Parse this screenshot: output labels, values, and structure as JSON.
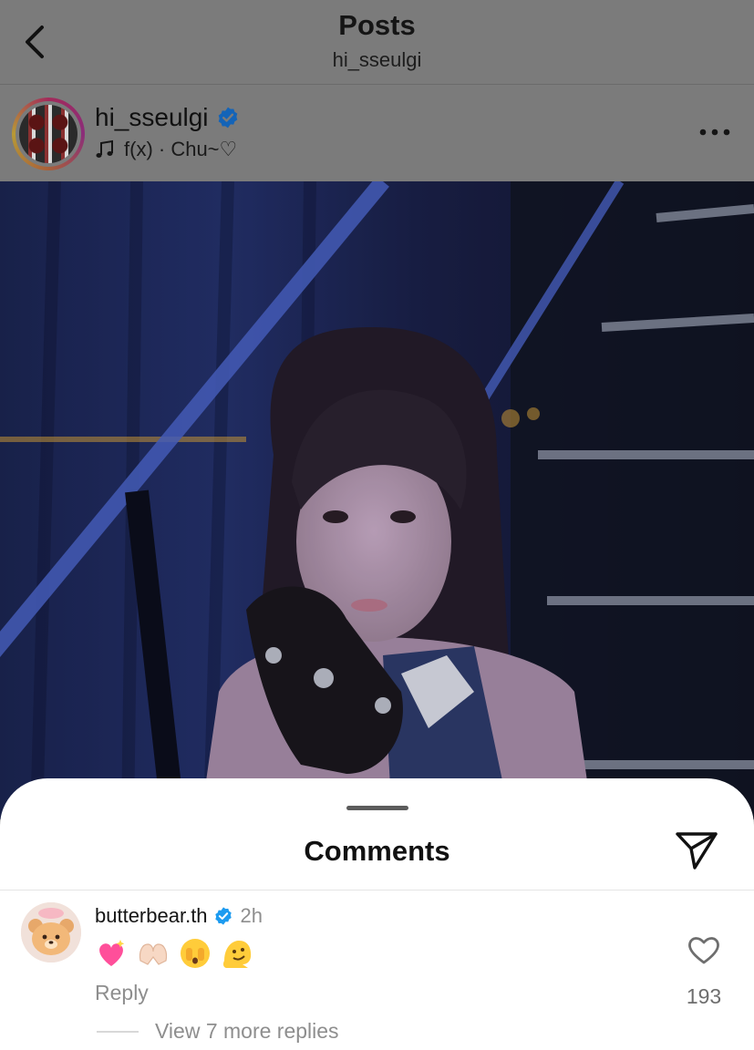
{
  "header": {
    "title": "Posts",
    "subtitle": "hi_sseulgi"
  },
  "post": {
    "username": "hi_sseulgi",
    "verified": true,
    "music": "f(x) · Chu~♡",
    "icons": [
      "back-chevron-icon",
      "music-note-icon",
      "verified-badge-icon",
      "more-dots-icon"
    ]
  },
  "comments_sheet": {
    "title": "Comments",
    "comment": {
      "username": "butterbear.th",
      "verified": true,
      "time": "2h",
      "emojis": [
        "sparkling-heart",
        "heart-hands",
        "face-holding-back-tears",
        "melting-face"
      ],
      "reply_label": "Reply",
      "likes": "193",
      "view_replies": "View 7 more replies"
    }
  },
  "colors": {
    "verified": "#1D9BF0",
    "overlay": "#7a7a7a",
    "muted_text": "#8e8e8e"
  }
}
